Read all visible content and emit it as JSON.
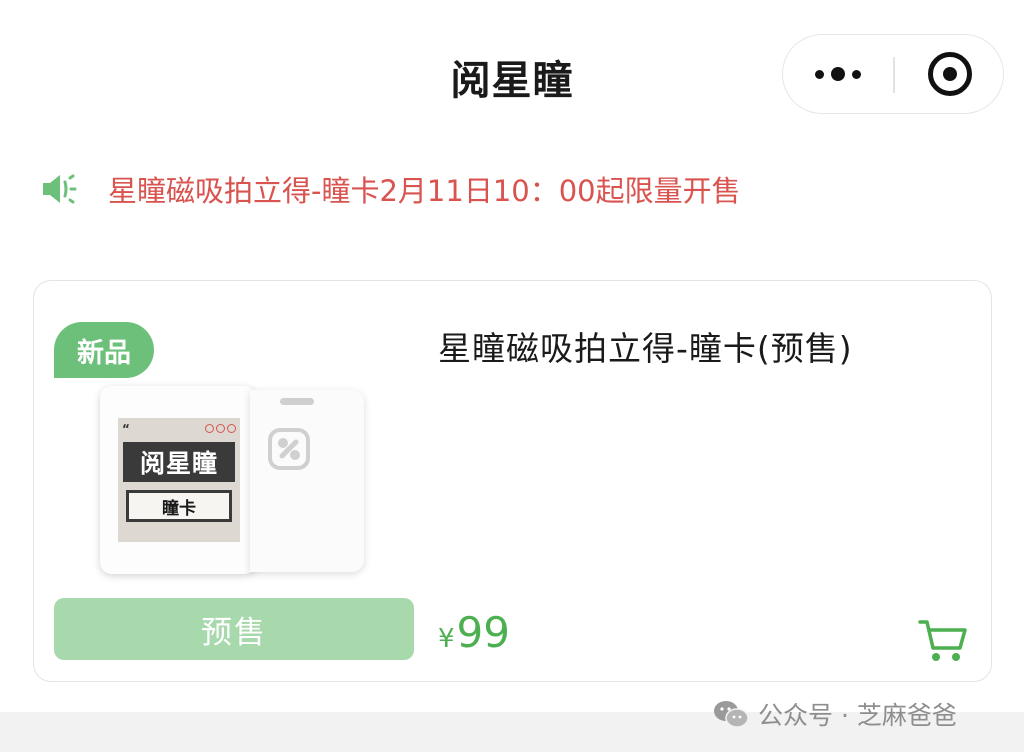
{
  "header": {
    "title": "阅星瞳"
  },
  "capsule": {
    "more_icon": "more-dots-icon",
    "close_icon": "target-close-icon"
  },
  "notice": {
    "icon": "speaker-icon",
    "text": "星瞳磁吸拍立得-瞳卡2月11日10：00起限量开售"
  },
  "product": {
    "badge": "新品",
    "name": "星瞳磁吸拍立得-瞳卡(预售)",
    "image": {
      "title": "阅星瞳",
      "subtitle": "瞳卡"
    },
    "presale_label": "预售",
    "currency": "¥",
    "price": "99",
    "cart_icon": "cart-icon"
  },
  "watermark": {
    "text": "公众号 · 芝麻爸爸"
  },
  "colors": {
    "accent_green": "#6dc07a",
    "price_green": "#4caf50",
    "notice_red": "#d9534f",
    "button_green": "#a8d9ad"
  }
}
